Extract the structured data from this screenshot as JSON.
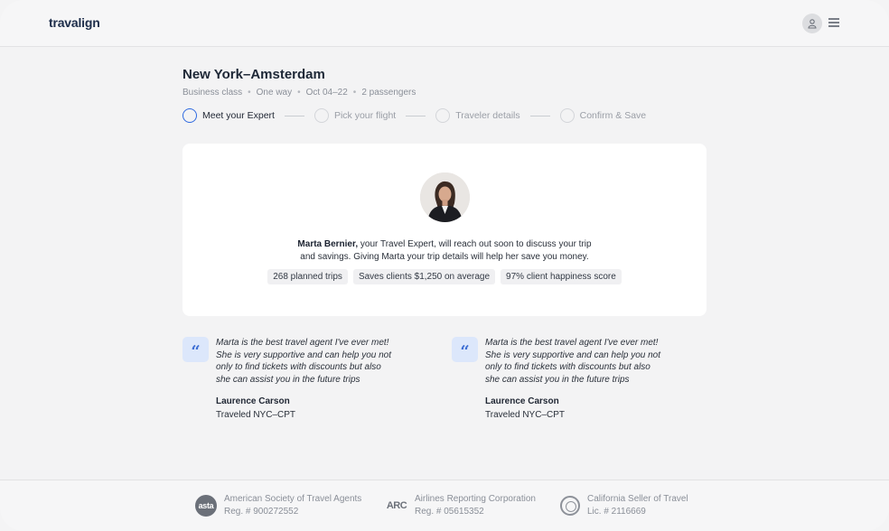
{
  "header": {
    "logo": "travalign",
    "profile_icon": "user-icon",
    "menu_icon": "hamburger-menu-icon"
  },
  "trip": {
    "title": "New York–Amsterdam",
    "details": [
      "Business class",
      "One way",
      "Oct 04–22",
      "2 passengers"
    ],
    "separator": "•"
  },
  "steps": [
    {
      "label": "Meet your Expert",
      "active": true
    },
    {
      "label": "Pick your flight",
      "active": false
    },
    {
      "label": "Traveler details",
      "active": false
    },
    {
      "label": "Confirm & Save",
      "active": false
    }
  ],
  "expert": {
    "name": "Marta Bernier,",
    "line1_rest": " your Travel Expert, will reach out soon to discuss your trip",
    "line2": "and savings. Giving Marta your trip details will help her save you money.",
    "stats": [
      "268 planned trips",
      "Saves clients $1,250 on average",
      "97% client happiness score"
    ]
  },
  "testimonials": [
    {
      "quote_mark": "“",
      "lines": [
        "Marta is the best travel agent I've ever met!",
        "She is very supportive and can help you not",
        "only to find tickets with discounts but also",
        "she can assist you in the future trips"
      ],
      "author": "Laurence Carson",
      "route": "Traveled NYC–CPT"
    },
    {
      "quote_mark": "“",
      "lines": [
        "Marta is the best travel agent I've ever met!",
        "She is very supportive and can help you not",
        "only to find tickets with discounts but also",
        "she can assist you in the future trips"
      ],
      "author": "Laurence Carson",
      "route": "Traveled NYC–CPT"
    }
  ],
  "footer": [
    {
      "logo": "asta",
      "name": "American Society of Travel Agents",
      "reg": "Reg. # 900272552"
    },
    {
      "logo": "ARC",
      "name": "Airlines Reporting Corporation",
      "reg": "Reg. # 05615352"
    },
    {
      "logo": "california-seal-icon",
      "name": "California Seller of Travel",
      "reg": "Lic. # 2116669"
    }
  ],
  "colors": {
    "accent": "#2f6ae0",
    "quote_bg": "#dce7fb",
    "page_bg": "#f3f3f4"
  }
}
